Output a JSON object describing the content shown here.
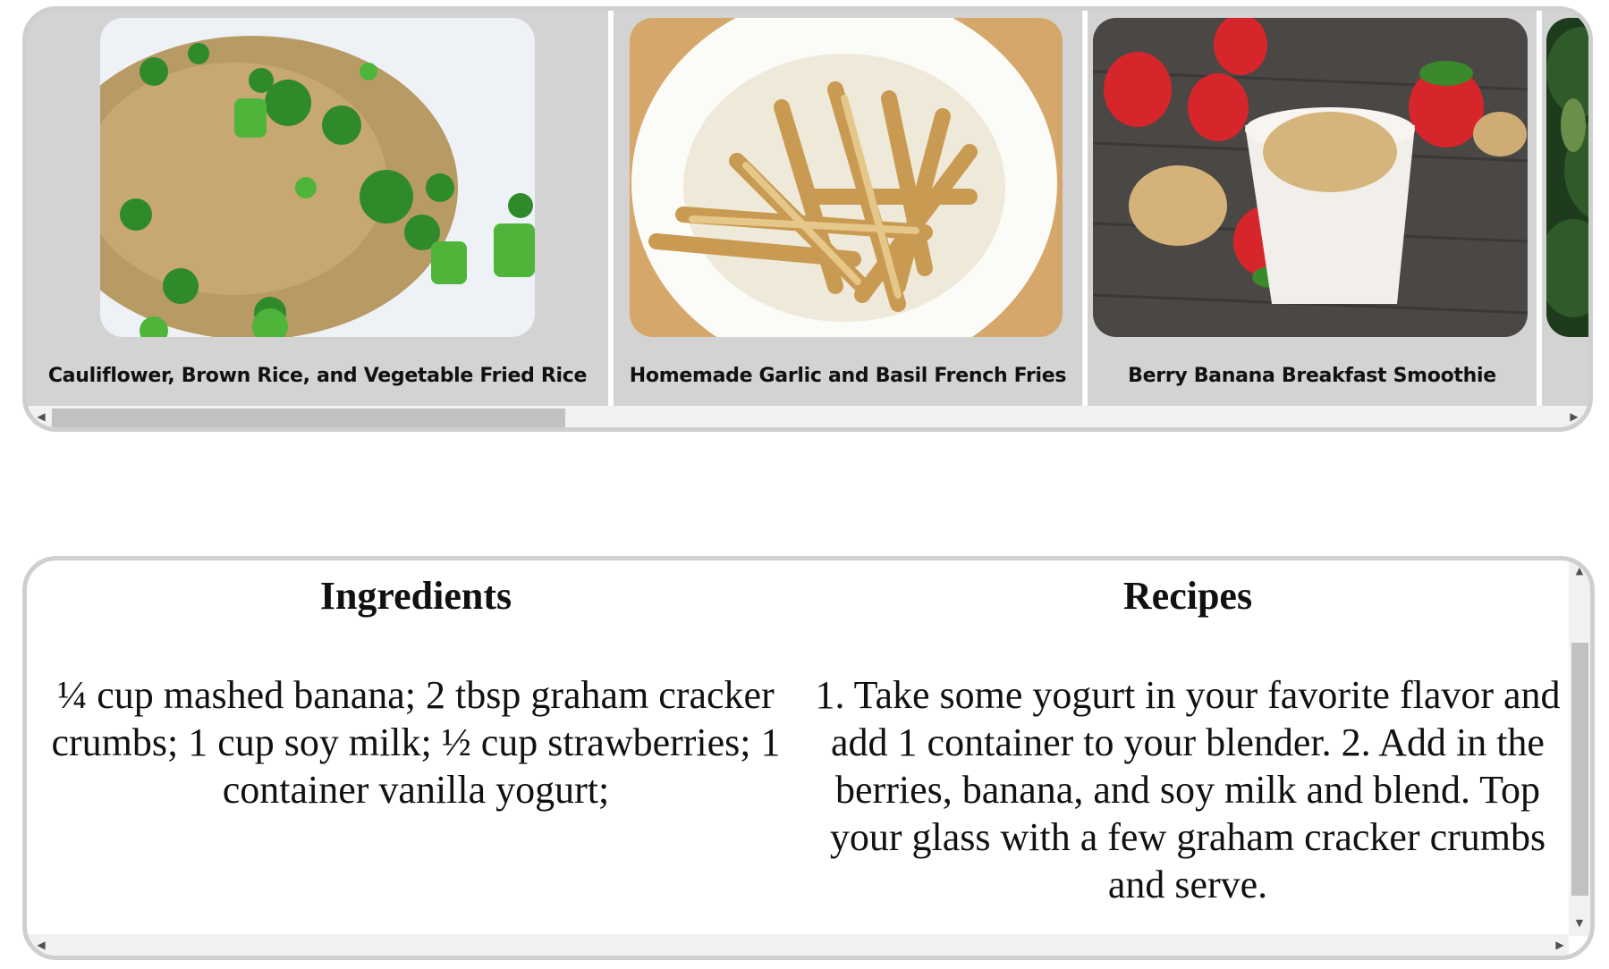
{
  "carousel": {
    "cards": [
      {
        "caption": "Cauliflower, Brown Rice, and Vegetable Fried Rice",
        "image": "fried-rice-photo"
      },
      {
        "caption": "Homemade Garlic and Basil French Fries",
        "image": "french-fries-photo"
      },
      {
        "caption": "Berry Banana Breakfast Smoothie",
        "image": "smoothie-photo"
      },
      {
        "caption": "",
        "image": "greens-photo"
      }
    ],
    "scroll_left_icon": "◀",
    "scroll_right_icon": "▶"
  },
  "recipe": {
    "ingredients_heading": "Ingredients",
    "recipes_heading": "Recipes",
    "ingredients_text": "¼ cup mashed banana; 2 tbsp graham cracker crumbs; 1 cup soy milk; ½ cup strawberries; 1 container vanilla yogurt;",
    "recipe_text": "1. Take some yogurt in your favorite flavor and add 1 container to your blender. 2. Add in the berries, banana, and soy milk and blend. Top your glass with a few graham cracker crumbs and serve.",
    "scroll_up_icon": "▲",
    "scroll_down_icon": "▼",
    "scroll_left_icon": "◀",
    "scroll_right_icon": "▶"
  }
}
